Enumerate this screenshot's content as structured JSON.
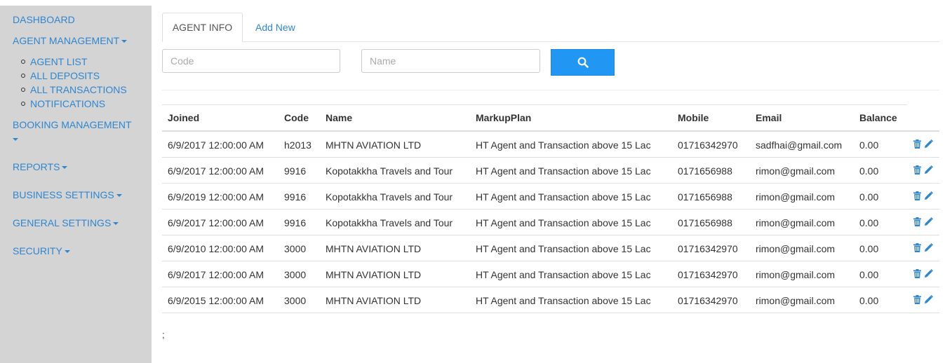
{
  "sidebar": {
    "items": [
      {
        "label": "DASHBOARD"
      },
      {
        "label": "AGENT MANAGEMENT",
        "sub": [
          "AGENT LIST",
          "ALL DEPOSITS",
          "ALL TRANSACTIONS",
          "NOTIFICATIONS"
        ]
      },
      {
        "label": "BOOKING MANAGEMENT"
      },
      {
        "label": "REPORTS"
      },
      {
        "label": "BUSINESS SETTINGS"
      },
      {
        "label": "GENERAL SETTINGS"
      },
      {
        "label": "SECURITY"
      }
    ]
  },
  "tabs": {
    "active": "AGENT INFO",
    "add_new": "Add New"
  },
  "search": {
    "code_placeholder": "Code",
    "name_placeholder": "Name",
    "icon": "search-icon"
  },
  "table": {
    "headers": [
      "Joined",
      "Code",
      "Name",
      "MarkupPlan",
      "Mobile",
      "Email",
      "Balance"
    ],
    "rows": [
      [
        "6/9/2017 12:00:00 AM",
        "h2013",
        "MHTN AVIATION LTD",
        "HT Agent and Transaction above 15 Lac",
        "01716342970",
        "sadfhai@gmail.com",
        "0.00"
      ],
      [
        "6/9/2017 12:00:00 AM",
        "9916",
        "Kopotakkha Travels and Tour",
        "HT Agent and Transaction above 15 Lac",
        "0171656988",
        "rimon@gmail.com",
        "0.00"
      ],
      [
        "6/9/2019 12:00:00 AM",
        "9916",
        "Kopotakkha Travels and Tour",
        "HT Agent and Transaction above 15 Lac",
        "0171656988",
        "rimon@gmail.com",
        "0.00"
      ],
      [
        "6/9/2017 12:00:00 AM",
        "9916",
        "Kopotakkha Travels and Tour",
        "HT Agent and Transaction above 15 Lac",
        "0171656988",
        "rimon@gmail.com",
        "0.00"
      ],
      [
        "6/9/2010 12:00:00 AM",
        "3000",
        "MHTN AVIATION LTD",
        "HT Agent and Transaction above 15 Lac",
        "01716342970",
        "rimon@gmail.com",
        "0.00"
      ],
      [
        "6/9/2017 12:00:00 AM",
        "3000",
        "MHTN AVIATION LTD",
        "HT Agent and Transaction above 15 Lac",
        "01716342970",
        "rimon@gmail.com",
        "0.00"
      ],
      [
        "6/9/2015 12:00:00 AM",
        "3000",
        "MHTN AVIATION LTD",
        "HT Agent and Transaction above 15 Lac",
        "01716342970",
        "rimon@gmail.com",
        "0.00"
      ]
    ],
    "row_icons": [
      "trash-icon",
      "pencil-icon"
    ]
  },
  "footer": {
    "text": ";"
  },
  "colors": {
    "link": "#2f86cf",
    "sidebar_bg": "#d4d4d4",
    "search_button": "#2196f3"
  }
}
